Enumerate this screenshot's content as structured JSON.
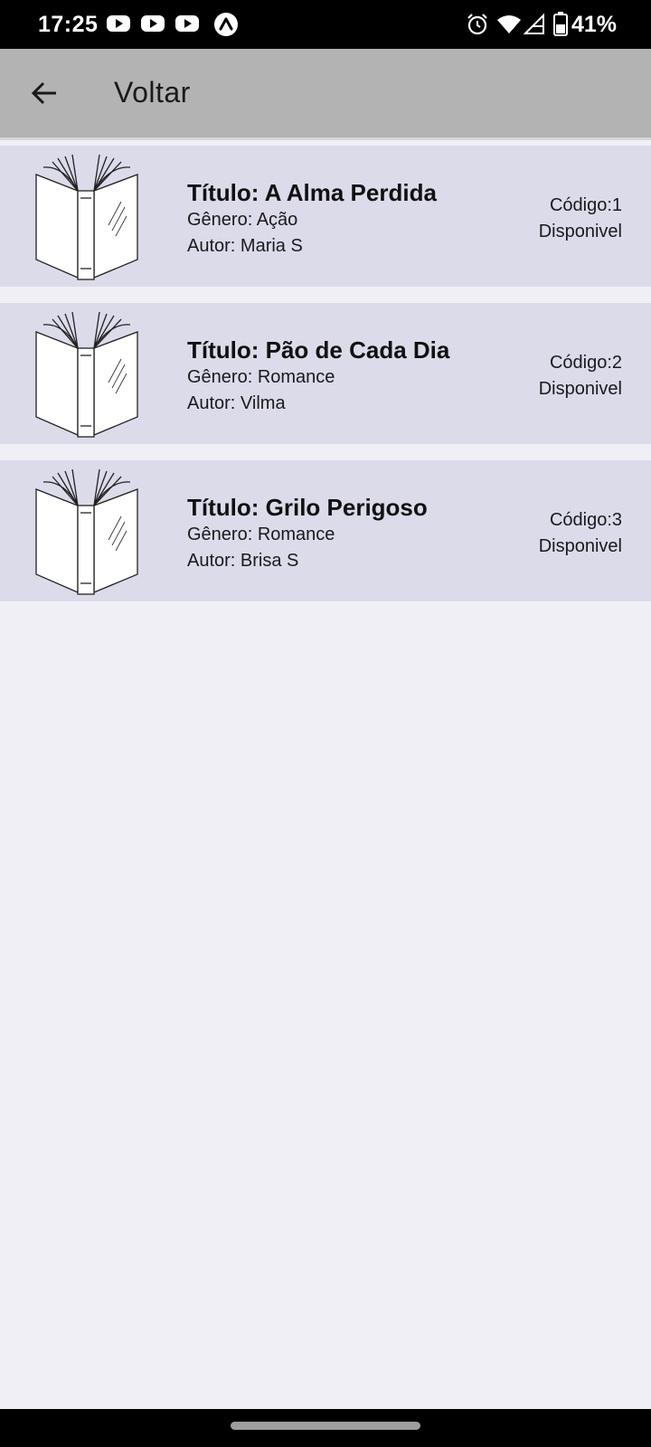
{
  "status_bar": {
    "time": "17:25",
    "battery": "41%",
    "icons": [
      "youtube-icon",
      "youtube-icon",
      "youtube-icon",
      "navigation-icon",
      "alarm-icon",
      "wifi-icon",
      "signal-icon",
      "battery-icon"
    ]
  },
  "header": {
    "back_icon": "arrow-left-icon",
    "title": "Voltar",
    "background": "#b3b3b3"
  },
  "books": [
    {
      "title": "Título: A Alma Perdida",
      "genre": "Gênero: Ação",
      "author": "Autor: Maria S",
      "code": "Código:1",
      "status": "Disponivel",
      "image_icon": "open-book-icon"
    },
    {
      "title": "Título: Pão de Cada Dia",
      "genre": "Gênero: Romance",
      "author": "Autor: Vilma",
      "code": "Código:2",
      "status": "Disponivel",
      "image_icon": "open-book-icon"
    },
    {
      "title": "Título: Grilo Perigoso",
      "genre": "Gênero: Romance",
      "author": "Autor: Brisa S",
      "code": "Código:3",
      "status": "Disponivel",
      "image_icon": "open-book-icon"
    }
  ],
  "colors": {
    "page_background": "#efeff5",
    "card_background": "#dbdbea",
    "status_bar": "#000000"
  }
}
